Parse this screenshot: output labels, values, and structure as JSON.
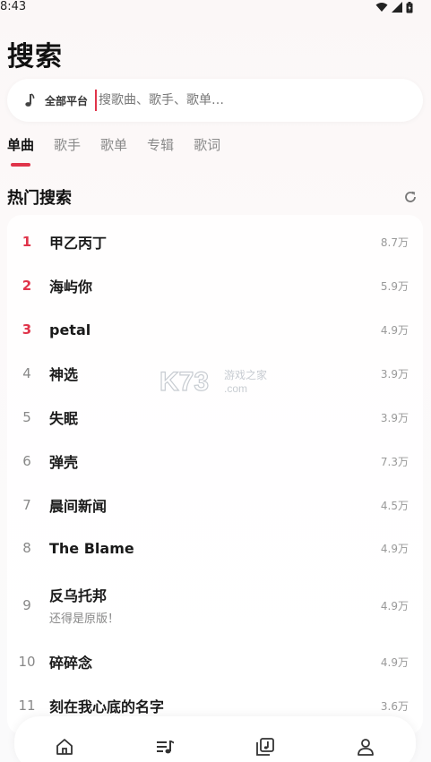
{
  "status": {
    "time": "8:43"
  },
  "page": {
    "title": "搜索"
  },
  "search": {
    "platform_label": "全部平台",
    "placeholder": "搜歌曲、歌手、歌单…",
    "value": ""
  },
  "tabs": [
    {
      "label": "单曲",
      "active": true
    },
    {
      "label": "歌手",
      "active": false
    },
    {
      "label": "歌单",
      "active": false
    },
    {
      "label": "专辑",
      "active": false
    },
    {
      "label": "歌词",
      "active": false
    }
  ],
  "hot": {
    "title": "热门搜索",
    "items": [
      {
        "rank": "1",
        "title": "甲乙丙丁",
        "sub": "",
        "count": "8.7万"
      },
      {
        "rank": "2",
        "title": "海屿你",
        "sub": "",
        "count": "5.9万"
      },
      {
        "rank": "3",
        "title": "petal",
        "sub": "",
        "count": "4.9万"
      },
      {
        "rank": "4",
        "title": "神选",
        "sub": "",
        "count": "3.9万"
      },
      {
        "rank": "5",
        "title": "失眠",
        "sub": "",
        "count": "3.9万"
      },
      {
        "rank": "6",
        "title": "弹壳",
        "sub": "",
        "count": "7.3万"
      },
      {
        "rank": "7",
        "title": "晨间新闻",
        "sub": "",
        "count": "4.5万"
      },
      {
        "rank": "8",
        "title": "The Blame",
        "sub": "",
        "count": "4.9万"
      },
      {
        "rank": "9",
        "title": "反乌托邦",
        "sub": "还得是原版！",
        "count": "4.9万"
      },
      {
        "rank": "10",
        "title": "碎碎念",
        "sub": "",
        "count": "4.9万"
      },
      {
        "rank": "11",
        "title": "刻在我心底的名字",
        "sub": "",
        "count": "3.6万"
      }
    ]
  },
  "watermark": {
    "brand": "K73",
    "tagline": "游戏之家",
    "domain": ".com"
  },
  "colors": {
    "accent": "#e0344a",
    "muted": "#8a8a8a"
  },
  "nav": [
    "home-icon",
    "playlist-icon",
    "library-icon",
    "profile-icon"
  ]
}
